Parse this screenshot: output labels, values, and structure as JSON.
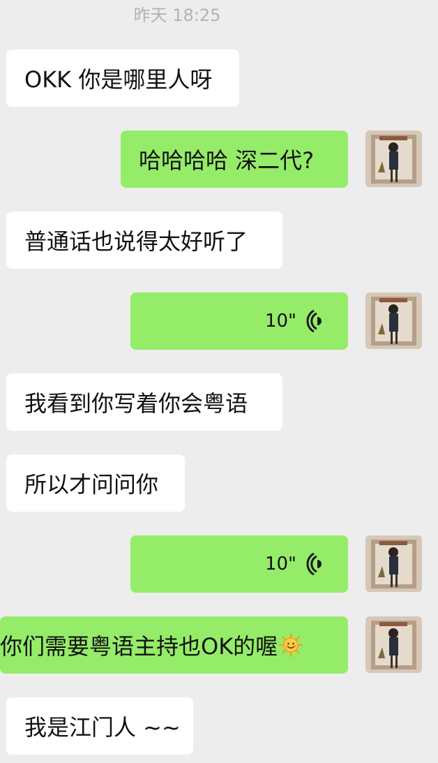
{
  "timestamp": "昨天 18:25",
  "messages": [
    {
      "side": "left",
      "text": "OKK 你是哪里人呀"
    },
    {
      "side": "right",
      "text": "哈哈哈哈 深二代?"
    },
    {
      "side": "left",
      "text": "普通话也说得太好听了"
    },
    {
      "side": "right",
      "type": "voice",
      "duration": "10\""
    },
    {
      "side": "left",
      "text": "我看到你写着你会粤语"
    },
    {
      "side": "left",
      "text": "所以才问问你"
    },
    {
      "side": "right",
      "type": "voice",
      "duration": "10\""
    },
    {
      "side": "right",
      "text": "你们需要粤语主持也OK的喔",
      "emoji": "sun-smile-emoji"
    },
    {
      "side": "left",
      "text": "我是江门人 ~~"
    }
  ],
  "colors": {
    "background": "#ededed",
    "incoming_bubble": "#ffffff",
    "outgoing_bubble": "#95ec69",
    "timestamp": "#b2b2b2"
  }
}
